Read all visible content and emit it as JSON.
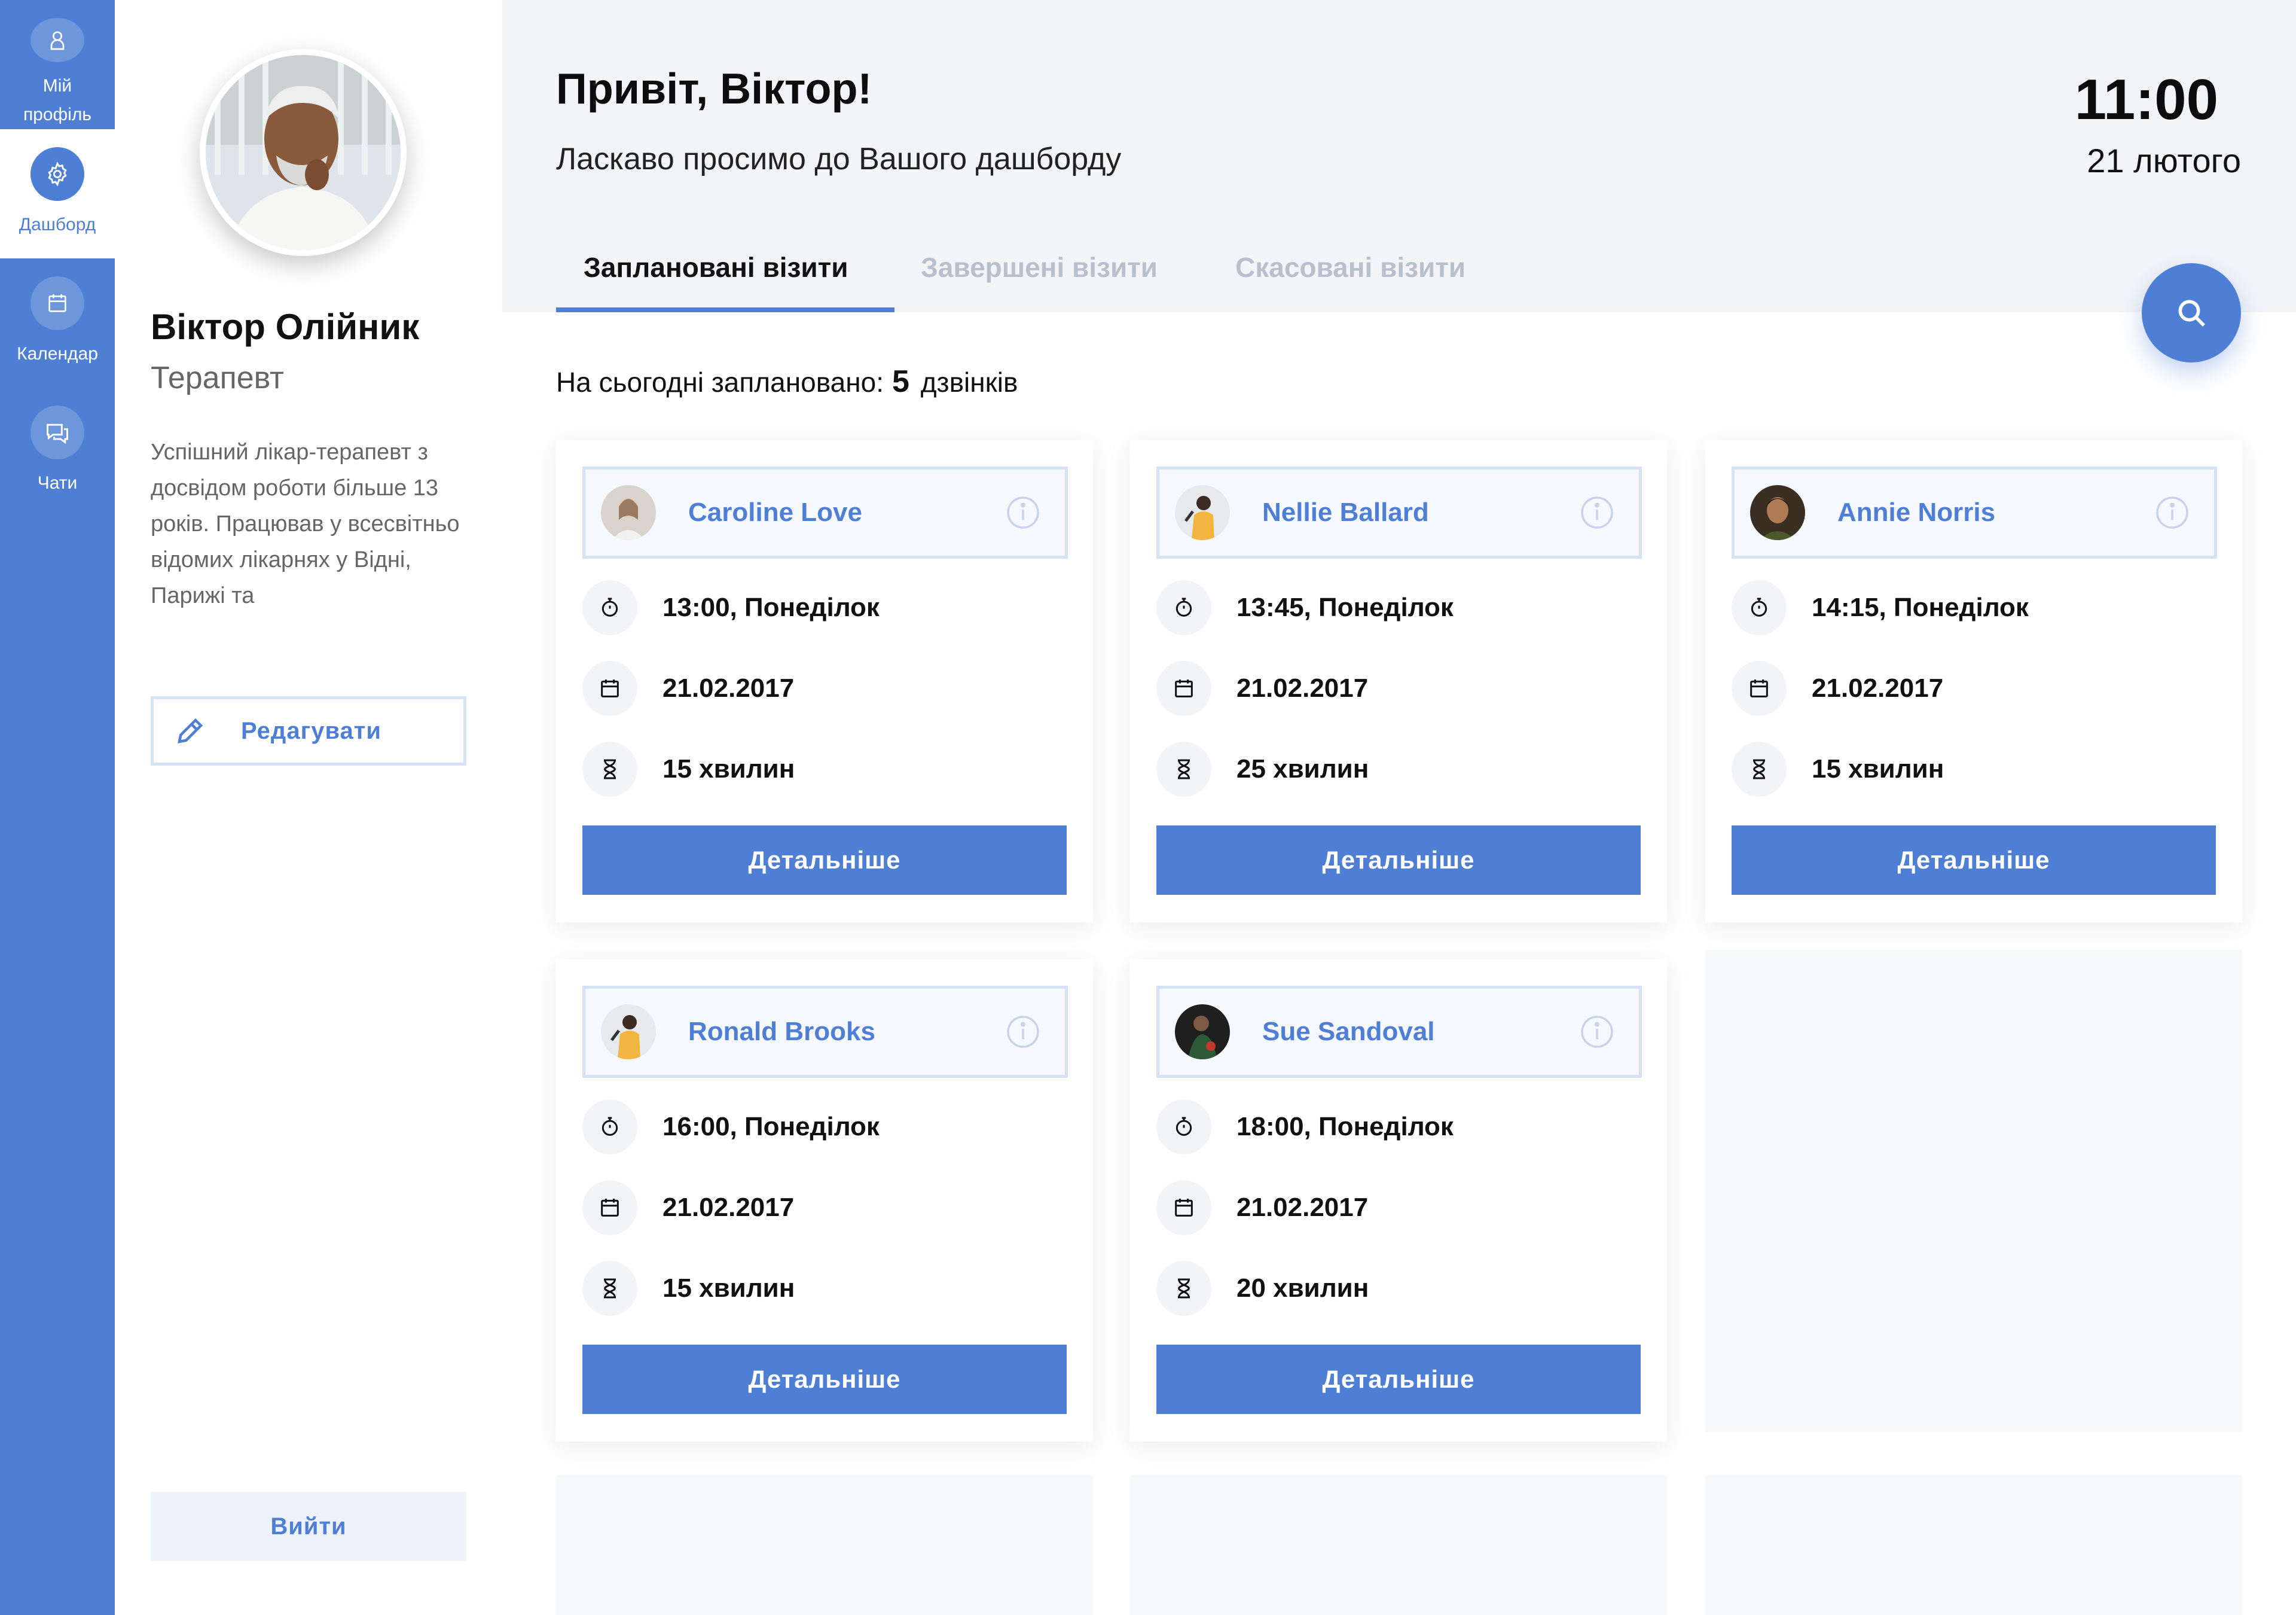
{
  "nav": {
    "items": [
      {
        "label": "Мій профіль",
        "icon": "user-icon"
      },
      {
        "label": "Дашборд",
        "icon": "gear-icon"
      },
      {
        "label": "Календар",
        "icon": "calendar-icon"
      },
      {
        "label": "Чати",
        "icon": "chat-icon"
      }
    ],
    "active_index": 1,
    "accent_color": "#4e7fd4"
  },
  "profile": {
    "name": "Віктор Олійник",
    "role": "Терапевт",
    "bio": "Успішний лікар-терапевт з досвідом роботи більше 13 років. Працював у всесвітньо відомих лікарнях у Відні, Парижі та",
    "edit_label": "Редагувати",
    "logout_label": "Вийти"
  },
  "header": {
    "greeting": "Привіт, Віктор!",
    "welcome": "Ласкаво просимо до Вашого дашборду",
    "time": "11:00",
    "date": "21 лютого"
  },
  "tabs": [
    {
      "label": "Заплановані візити",
      "active": true
    },
    {
      "label": "Завершені візити",
      "active": false
    },
    {
      "label": "Скасовані візити",
      "active": false
    }
  ],
  "summary": {
    "prefix": "На сьогодні заплановано:",
    "count": "5",
    "suffix": "дзвінків"
  },
  "appointments": [
    {
      "patient": "Caroline Love",
      "time": "13:00, Понеділок",
      "date": "21.02.2017",
      "duration": "15 хвилин",
      "button": "Детальніше"
    },
    {
      "patient": "Nellie Ballard",
      "time": "13:45, Понеділок",
      "date": "21.02.2017",
      "duration": "25 хвилин",
      "button": "Детальніше"
    },
    {
      "patient": "Annie Norris",
      "time": "14:15, Понеділок",
      "date": "21.02.2017",
      "duration": "15 хвилин",
      "button": "Детальніше"
    },
    {
      "patient": "Ronald Brooks",
      "time": "16:00, Понеділок",
      "date": "21.02.2017",
      "duration": "15 хвилин",
      "button": "Детальніше"
    },
    {
      "patient": "Sue Sandoval",
      "time": "18:00, Понеділок",
      "date": "21.02.2017",
      "duration": "20 хвилин",
      "button": "Детальніше"
    }
  ]
}
